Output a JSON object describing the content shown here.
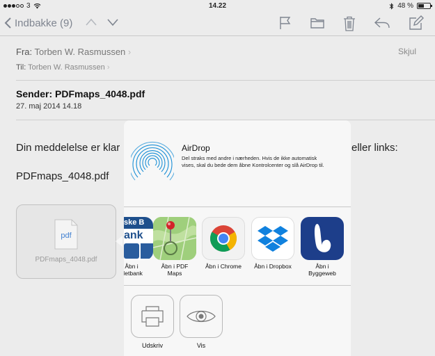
{
  "status_bar": {
    "carrier": "3",
    "time": "14.22",
    "battery": "48 %",
    "battery_level": 0.48
  },
  "toolbar": {
    "back_label": "Indbakke (9)",
    "icons": [
      "chevron-up-icon",
      "chevron-down-icon",
      "flag-icon",
      "folder-icon",
      "trash-icon",
      "reply-icon",
      "compose-icon"
    ]
  },
  "mail": {
    "from_label": "Fra:",
    "from_name": "Torben W. Rasmussen",
    "to_label": "Til:",
    "to_name": "Torben W. Rasmussen",
    "hide_label": "Skjul",
    "subject": "Sender: PDFmaps_4048.pdf",
    "date": "27. maj 2014 14.18",
    "body_left": "Din meddelelse er klar",
    "body_right": "eller links:",
    "body_file": "PDFmaps_4048.pdf",
    "attachment": {
      "badge": "pdf",
      "filename": "PDFmaps_4048.pdf"
    }
  },
  "share_sheet": {
    "airdrop": {
      "title": "AirDrop",
      "text": "Del straks med andre i nærheden. Hvis de ikke automatisk vises, skal du bede dem åbne Kontrolcenter og slå AirDrop til."
    },
    "apps": [
      {
        "line1": "Åbn i",
        "line2": "Netbank",
        "icon": "netbank-icon",
        "text1": "ske B",
        "text2": "ank"
      },
      {
        "line1": "Åbn i PDF",
        "line2": "Maps",
        "icon": "pdf-maps-icon"
      },
      {
        "line1": "Åbn i Chrome",
        "line2": "",
        "icon": "chrome-icon"
      },
      {
        "line1": "Åbn i Dropbox",
        "line2": "",
        "icon": "dropbox-icon"
      },
      {
        "line1": "Åbn i",
        "line2": "Byggeweb",
        "icon": "byggeweb-icon"
      }
    ],
    "actions": [
      {
        "label": "Udskriv",
        "icon": "print-icon"
      },
      {
        "label": "Vis",
        "icon": "eye-icon"
      }
    ]
  },
  "colors": {
    "toolbar_icon": "#7f8590",
    "background": "#ececec",
    "sheet": "#f7f7f7",
    "airdrop_blue": "#1a8fd6"
  }
}
